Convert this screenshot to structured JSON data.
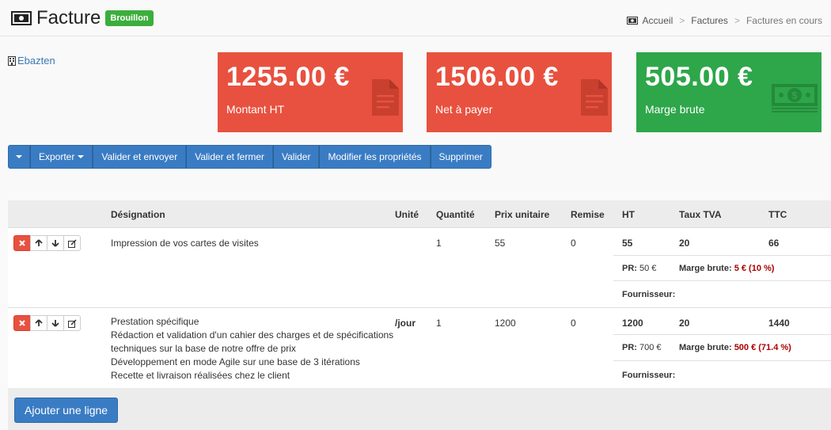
{
  "header": {
    "title": "Facture",
    "status_badge": "Brouillon",
    "breadcrumb": [
      "Accueil",
      "Factures",
      "Factures en cours"
    ]
  },
  "company": {
    "name": "Ebazten"
  },
  "stats": [
    {
      "amount": "1255.00 €",
      "label": "Montant HT",
      "icon": "document-icon",
      "color": "#e8513f"
    },
    {
      "amount": "1506.00 €",
      "label": "Net à payer",
      "icon": "document-icon",
      "color": "#e8513f"
    },
    {
      "amount": "505.00 €",
      "label": "Marge brute",
      "icon": "money-icon",
      "color": "#2ea64a"
    }
  ],
  "toolbar": {
    "export": "Exporter",
    "validate_send": "Valider et envoyer",
    "validate_close": "Valider et fermer",
    "validate": "Valider",
    "edit_props": "Modifier les propriétés",
    "delete": "Supprimer"
  },
  "table": {
    "headers": {
      "designation": "Désignation",
      "unit": "Unité",
      "quantity": "Quantité",
      "unit_price": "Prix unitaire",
      "discount": "Remise",
      "ht": "HT",
      "vat": "Taux TVA",
      "ttc": "TTC"
    },
    "rows": [
      {
        "designation_lines": [
          "Impression de vos cartes de visites"
        ],
        "unit": "",
        "quantity": "1",
        "unit_price": "55",
        "discount": "0",
        "ht": "55",
        "vat": "20",
        "ttc": "66",
        "pr_label": "PR:",
        "pr_value": "50 €",
        "margin_label": "Marge brute:",
        "margin_value": "5 € (10 %)",
        "supplier_label": "Fournisseur:"
      },
      {
        "designation_lines": [
          "Prestation spécifique",
          "Rédaction et validation d'un cahier des charges et de spécifications",
          "techniques sur la base de notre offre de prix",
          "Développement en mode Agile sur une base de 3 itérations",
          "Recette et livraison réalisées chez le client"
        ],
        "unit": "/jour",
        "quantity": "1",
        "unit_price": "1200",
        "discount": "0",
        "ht": "1200",
        "vat": "20",
        "ttc": "1440",
        "pr_label": "PR:",
        "pr_value": "700 €",
        "margin_label": "Marge brute:",
        "margin_value": "500 € (71.4 %)",
        "supplier_label": "Fournisseur:"
      }
    ]
  },
  "footer": {
    "add_line": "Ajouter une ligne"
  }
}
